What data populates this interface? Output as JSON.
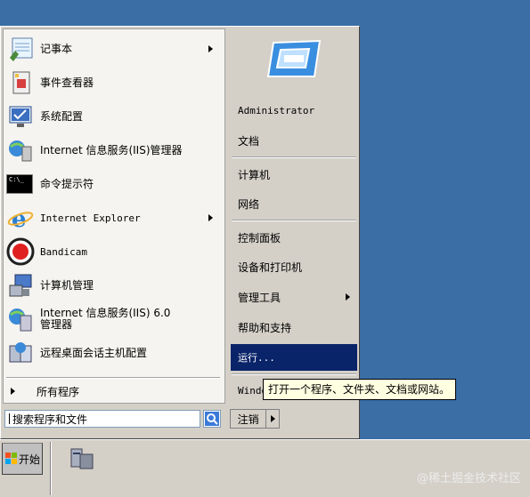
{
  "start_menu": {
    "programs": [
      {
        "label": "记事本",
        "icon": "notepad-icon",
        "has_submenu": true
      },
      {
        "label": "事件查看器",
        "icon": "event-viewer-icon",
        "has_submenu": false
      },
      {
        "label": "系统配置",
        "icon": "system-config-icon",
        "has_submenu": false
      },
      {
        "label": "Internet 信息服务(IIS)管理器",
        "icon": "iis-manager-icon",
        "has_submenu": false
      },
      {
        "label": "命令提示符",
        "icon": "cmd-icon",
        "icon_text": "C:\\_",
        "has_submenu": false
      },
      {
        "label": "Internet Explorer",
        "icon": "ie-icon",
        "has_submenu": true
      },
      {
        "label": "Bandicam",
        "icon": "bandicam-icon",
        "has_submenu": false
      },
      {
        "label": "计算机管理",
        "icon": "computer-management-icon",
        "has_submenu": false
      },
      {
        "label": "Internet 信息服务(IIS) 6.0\n管理器",
        "icon": "iis6-manager-icon",
        "has_submenu": false
      },
      {
        "label": "远程桌面会话主机配置",
        "icon": "remote-desktop-icon",
        "has_submenu": false
      }
    ],
    "all_programs_label": "所有程序",
    "search_placeholder": "搜索程序和文件",
    "right": {
      "user": "Administrator",
      "documents": "文档",
      "computer": "计算机",
      "network": "网络",
      "control_panel": "控制面板",
      "devices_printers": "设备和打印机",
      "admin_tools": "管理工具",
      "help": "帮助和支持",
      "run": "运行...",
      "windows_security": "Windows 安全"
    },
    "logoff_label": "注销"
  },
  "tooltip": "打开一个程序、文件夹、文档或网站。",
  "taskbar": {
    "start_label": "开始"
  },
  "watermark": "@稀土掘金技术社区",
  "colors": {
    "desktop": "#3a6ea5",
    "menu_bg": "#d4d0c8",
    "highlight": "#0a246a"
  }
}
